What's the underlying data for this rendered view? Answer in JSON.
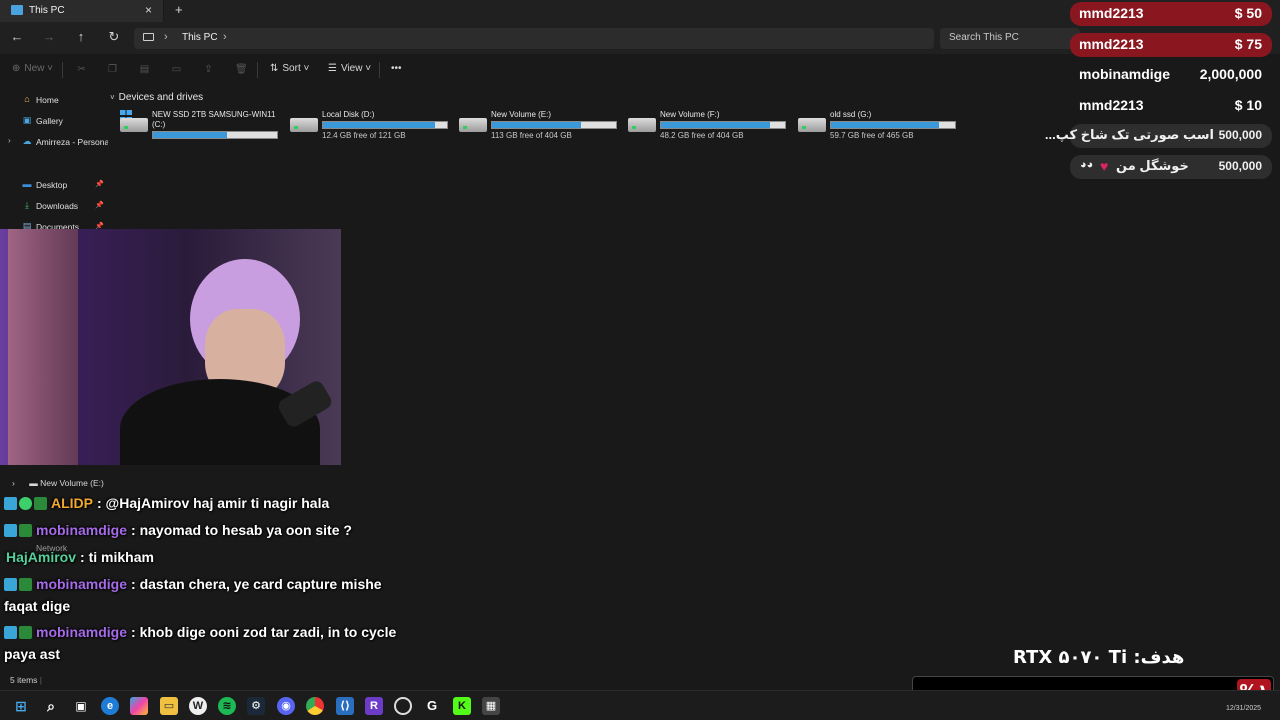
{
  "window": {
    "tab_title": "This PC",
    "tab_close": "×",
    "new_tab": "+"
  },
  "address": {
    "crumb": "This PC",
    "search_placeholder": "Search This PC"
  },
  "commands": {
    "new": "New",
    "sort": "Sort",
    "view": "View",
    "more": "•••"
  },
  "sidebar": {
    "items": [
      {
        "label": "Home",
        "icon": "home-icon"
      },
      {
        "label": "Gallery",
        "icon": "gallery-icon"
      },
      {
        "label": "Amirreza - Persona",
        "icon": "cloud-icon"
      },
      {
        "label": "Desktop",
        "icon": "desktop-icon"
      },
      {
        "label": "Downloads",
        "icon": "download-icon"
      },
      {
        "label": "Documents",
        "icon": "documents-icon"
      }
    ],
    "lower_items": [
      {
        "label": "New Volume (E:)"
      },
      {
        "label": "Network"
      }
    ]
  },
  "main": {
    "section_title": "Devices and drives",
    "drives": [
      {
        "name": "NEW SSD 2TB SAMSUNG-WIN11 (C:)",
        "free": "",
        "used_fraction": 0.6
      },
      {
        "name": "Local Disk (D:)",
        "free": "12.4 GB free of 121 GB",
        "used_fraction": 0.9
      },
      {
        "name": "New Volume (E:)",
        "free": "113 GB free of 404 GB",
        "used_fraction": 0.72
      },
      {
        "name": "New Volume (F:)",
        "free": "48.2 GB free of 404 GB",
        "used_fraction": 0.88
      },
      {
        "name": "old ssd (G:)",
        "free": "59.7 GB free of 465 GB",
        "used_fraction": 0.87
      }
    ]
  },
  "status": {
    "items_count": "5 items"
  },
  "chat": [
    {
      "user": "ALIDP",
      "user_color": "#f0a830",
      "text": ": @HajAmirov haj amir ti nagir hala",
      "badges": 3,
      "continuation": ""
    },
    {
      "user": "mobinamdige",
      "user_color": "#a56be8",
      "text": ": nayomad to hesab ya oon site ?",
      "badges": 2,
      "continuation": ""
    },
    {
      "user": "HajAmirov",
      "user_color": "#56d09a",
      "text": ": ti mikham",
      "badges": 0,
      "continuation": ""
    },
    {
      "user": "mobinamdige",
      "user_color": "#a56be8",
      "text": ": dastan chera, ye card capture mishe",
      "badges": 2,
      "continuation": "faqat dige"
    },
    {
      "user": "mobinamdige",
      "user_color": "#a56be8",
      "text": ": khob dige ooni zod tar zadi, in to cycle",
      "badges": 2,
      "continuation": "paya ast"
    }
  ],
  "donations": [
    {
      "name": "mmd2213",
      "amount": "$ 50",
      "style": "red"
    },
    {
      "name": "mmd2213",
      "amount": "$ 75",
      "style": "red"
    },
    {
      "name": "mobinamdige",
      "amount": "2,000,000",
      "style": "dark"
    },
    {
      "name": "mmd2213",
      "amount": "$ 10",
      "style": "dark"
    },
    {
      "name": "اسب صورتی تک شاخ کپ...",
      "amount": "500,000",
      "style": "grey"
    },
    {
      "name": "خوشگل من",
      "amount": "500,000",
      "style": "grey"
    }
  ],
  "goal": {
    "label": "هدف: RTX ۵۰۷۰ Ti",
    "percent_text": "%۱",
    "progress": 0.01
  },
  "taskbar": {
    "date": "12/31/2025"
  },
  "colors": {
    "accent_blue": "#3b98d9",
    "donation_red": "#8a1620",
    "goal_red": "#b0151f"
  }
}
